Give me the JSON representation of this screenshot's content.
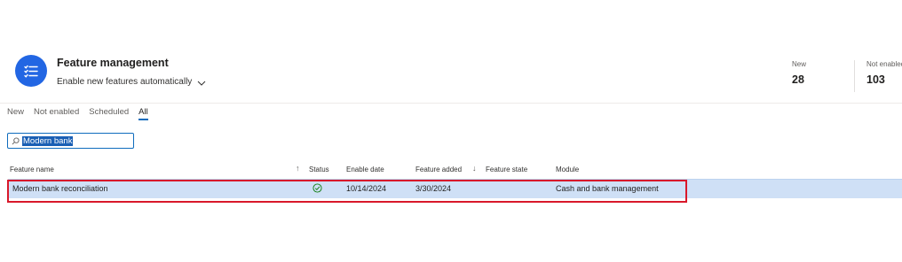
{
  "header": {
    "title": "Feature management",
    "subtitle": "Enable new features automatically",
    "stats": [
      {
        "label": "New",
        "value": "28"
      },
      {
        "label": "Not enabled",
        "value": "103"
      }
    ]
  },
  "tabs": [
    "New",
    "Not enabled",
    "Scheduled",
    "All"
  ],
  "active_tab": "All",
  "search": {
    "value": "Modern bank"
  },
  "grid": {
    "columns": [
      "Feature name",
      "Status",
      "Enable date",
      "Feature added",
      "Feature state",
      "Module"
    ],
    "rows": [
      {
        "feature_name": "Modern bank reconciliation",
        "status": "enabled",
        "enable_date": "10/14/2024",
        "feature_added": "3/30/2024",
        "feature_state": "",
        "module": "Cash and bank management"
      }
    ]
  },
  "colors": {
    "accent": "#2266e3",
    "selection": "#cfe0f6",
    "highlight_border": "#d9182a",
    "status_ok": "#107c10"
  }
}
